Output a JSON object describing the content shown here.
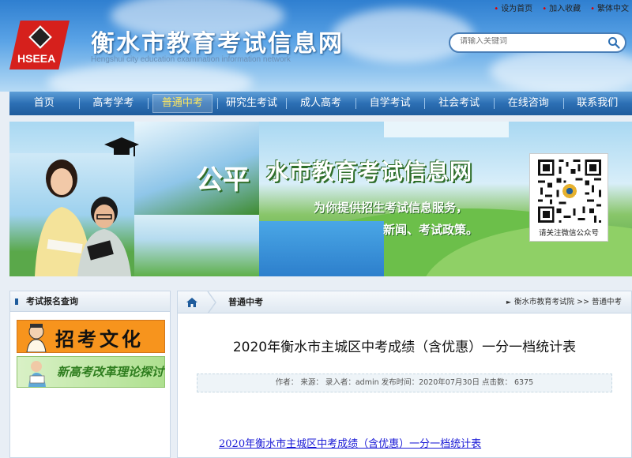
{
  "top_links": {
    "homepage": "设为首页",
    "favorite": "加入收藏",
    "traditional": "繁体中文"
  },
  "logo": {
    "text": "HSEEA"
  },
  "site": {
    "title": "衡水市教育考试信息网",
    "subtitle": "Hengshui city education examination information network"
  },
  "search": {
    "placeholder": "请输入关键词"
  },
  "nav": {
    "items": [
      {
        "label": "首页"
      },
      {
        "label": "高考学考"
      },
      {
        "label": "普通中考"
      },
      {
        "label": "研究生考试"
      },
      {
        "label": "成人高考"
      },
      {
        "label": "自学考试"
      },
      {
        "label": "社会考试"
      },
      {
        "label": "在线咨询"
      },
      {
        "label": "联系我们"
      }
    ],
    "active_index": 2
  },
  "banner": {
    "title": "水市教育考试信息网",
    "big_char": "公平",
    "slogan_line1": "为你提供招生考试信息服务，",
    "slogan_line2": "新闻、考试政策。",
    "qr_caption": "请关注微信公众号"
  },
  "sidebar": {
    "heading": "考试报名查询",
    "promo1_text": "招考文化",
    "promo2_text": "新高考改革理论探讨"
  },
  "main": {
    "section_title": "普通中考",
    "breadcrumb": {
      "root": "衡水市教育考试院",
      "separator": ">>",
      "current": "普通中考"
    },
    "article_title": "2020年衡水市主城区中考成绩（含优惠）一分一档统计表",
    "meta": "作者：  来源：  录入者：admin 发布时间：2020年07月30日 点击数：  6375",
    "attachment_link": "2020年衡水市主城区中考成绩（含优惠）一分一档统计表"
  },
  "colors": {
    "nav_active": "#ffe23a",
    "nav_bg": "#2c6fb4",
    "logo_red": "#d6201c",
    "link": "#1a1ad6"
  }
}
